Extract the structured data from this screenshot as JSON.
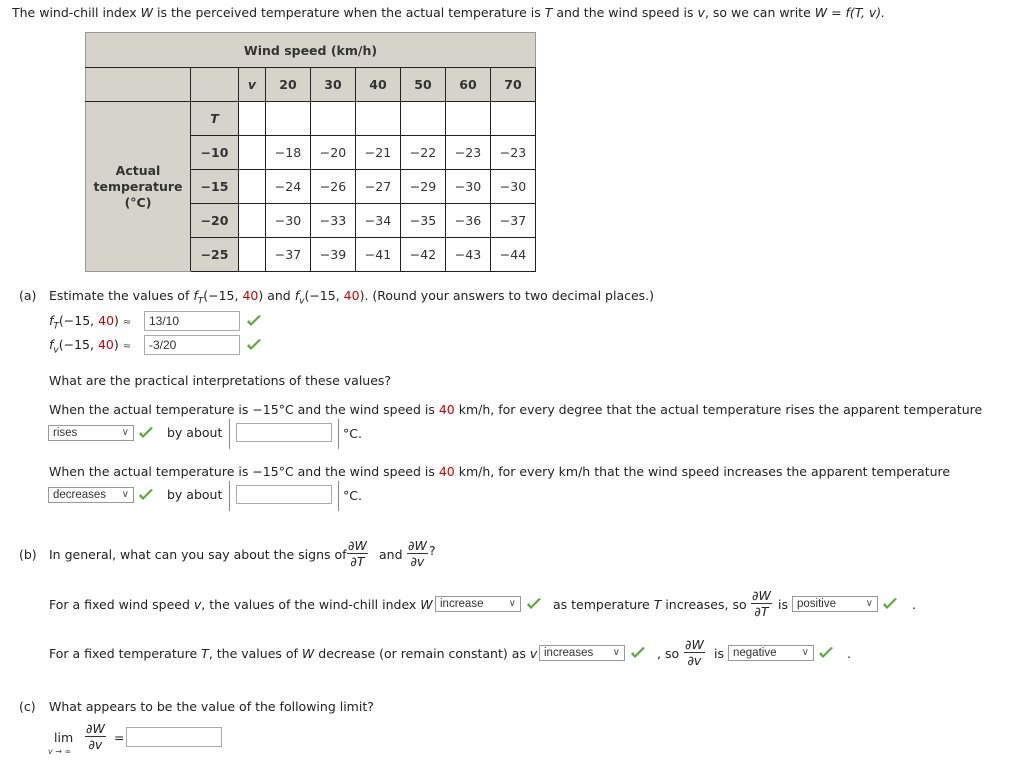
{
  "intro": {
    "part1": "The wind-chill index ",
    "W": "W",
    "part2": " is the perceived temperature when the actual temperature is ",
    "T": "T",
    "part3": " and the wind speed is ",
    "v": "v",
    "part4": ", so we can write ",
    "formula": "W = f(T, v)."
  },
  "table": {
    "title": "Wind speed (km/h)",
    "v_label": "v",
    "t_label": "T",
    "row_header_label": [
      "Actual",
      "temperature",
      "(°C)"
    ],
    "speeds": [
      "20",
      "30",
      "40",
      "50",
      "60",
      "70"
    ],
    "rows": [
      {
        "T": "−10",
        "values": [
          "−18",
          "−20",
          "−21",
          "−22",
          "−23",
          "−23"
        ]
      },
      {
        "T": "−15",
        "values": [
          "−24",
          "−26",
          "−27",
          "−29",
          "−30",
          "−30"
        ]
      },
      {
        "T": "−20",
        "values": [
          "−30",
          "−33",
          "−34",
          "−35",
          "−36",
          "−37"
        ]
      },
      {
        "T": "−25",
        "values": [
          "−37",
          "−39",
          "−41",
          "−42",
          "−43",
          "−44"
        ]
      }
    ]
  },
  "part_a": {
    "label": "(a)",
    "question_pre": "Estimate the values of ",
    "point_T": "−15, ",
    "point_v": "40",
    "question_post": ". (Round your answers to two decimal places.)",
    "fT_label": "f",
    "fT_sub": "T",
    "fv_label": "f",
    "fv_sub": "v",
    "approx": "≈",
    "fT_value": "13/10",
    "fv_value": "-3/20",
    "interp_question": "What are the practical interpretations of these values?",
    "interp1_pre": "When the actual temperature is −15°C and the wind speed is ",
    "interp1_speed": "40",
    "interp1_post": " km/h, for every degree that the actual temperature rises the apparent temperature",
    "interp1_select": "rises",
    "interp2_pre": "When the actual temperature is −15°C and the wind speed is ",
    "interp2_speed": "40",
    "interp2_post": " km/h, for every km/h that the wind speed increases the apparent temperature",
    "interp2_select": "decreases",
    "by_about": "by about",
    "unit": "°C.",
    "amount1_value": "",
    "amount2_value": ""
  },
  "part_b": {
    "label": "(b)",
    "question": "In general, what can you say about the signs of",
    "and": "and",
    "qmark": "?",
    "dW": "∂W",
    "dT": "∂T",
    "dv": "∂v",
    "s1_pre": "For a fixed wind speed ",
    "s1_v": "v",
    "s1_mid": ", the values of the wind-chill index ",
    "s1_W": "W",
    "s1_select": "increase",
    "s1_post_a": "as temperature ",
    "s1_T": "T",
    "s1_post_b": " increases, so",
    "is": "is",
    "s1_sign": "positive",
    "s2_pre": "For a fixed temperature ",
    "s2_T": "T",
    "s2_mid": ", the values of ",
    "s2_W": "W",
    "s2_post": " decrease (or remain constant) as ",
    "s2_v": "v",
    "s2_select": "increases",
    "s2_so": ", so",
    "s2_sign": "negative",
    "period": "."
  },
  "part_c": {
    "label": "(c)",
    "question": "What appears to be the value of the following limit?",
    "lim": "lim",
    "lim_sub": "v → ∞",
    "eq": "=",
    "answer": ""
  },
  "colors": {
    "header_bg": "#d6d3cb",
    "highlight": "#d40000",
    "check": "#5aaa3a"
  }
}
